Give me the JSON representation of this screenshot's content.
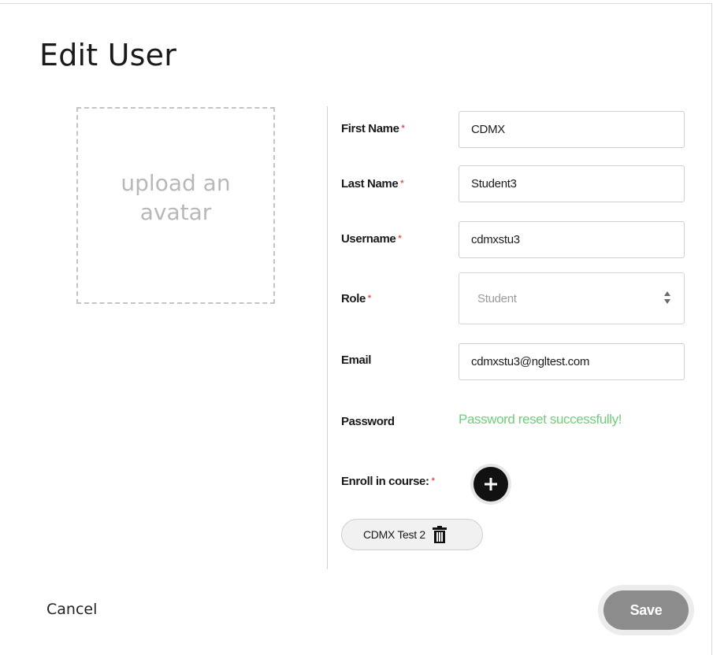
{
  "dialog": {
    "title": "Edit User",
    "avatar_upload_text": "upload an avatar",
    "required_marker": "*"
  },
  "form": {
    "first_name": {
      "label": "First Name",
      "value": "CDMX",
      "required": true
    },
    "last_name": {
      "label": "Last Name",
      "value": "Student3",
      "required": true
    },
    "username": {
      "label": "Username",
      "value": "cdmxstu3",
      "required": true
    },
    "role": {
      "label": "Role",
      "selected": "Student",
      "required": true
    },
    "email": {
      "label": "Email",
      "value": "cdmxstu3@ngltest.com",
      "required": false
    },
    "password": {
      "label": "Password",
      "status": "Password reset successfully!"
    },
    "enroll": {
      "label": "Enroll in course:",
      "required": true,
      "courses": [
        "CDMX Test 2"
      ]
    }
  },
  "actions": {
    "cancel_label": "Cancel",
    "save_label": "Save"
  },
  "colors": {
    "success": "#6ecf7a",
    "required": "#e2534d",
    "save_button": "#8c8c8c",
    "add_button": "#111111"
  },
  "icons": {
    "add": "plus-icon",
    "remove_course": "trash-icon",
    "select": "sort-arrows-icon"
  }
}
